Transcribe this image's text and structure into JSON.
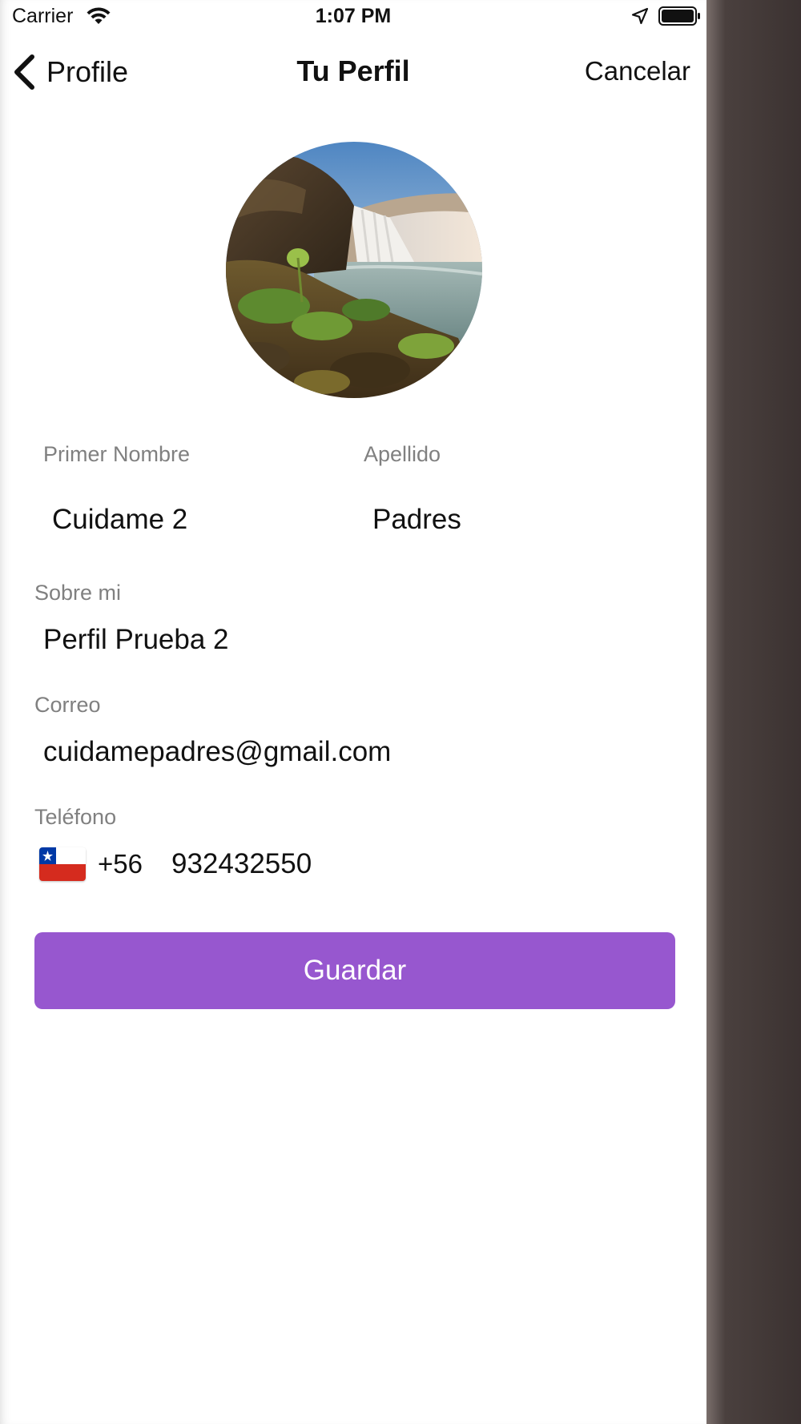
{
  "status_bar": {
    "carrier": "Carrier",
    "time": "1:07 PM",
    "icons": [
      "wifi-icon",
      "location-icon",
      "battery-icon"
    ]
  },
  "nav": {
    "back_label": "Profile",
    "title": "Tu Perfil",
    "cancel_label": "Cancelar"
  },
  "profile": {
    "first_name_label": "Primer Nombre",
    "first_name_value": "Cuidame 2",
    "last_name_label": "Apellido",
    "last_name_value": "Padres",
    "about_label": "Sobre mi",
    "about_value": "Perfil Prueba 2",
    "email_label": "Correo",
    "email_value": "cuidamepadres@gmail.com",
    "phone_label": "Teléfono",
    "phone_country_flag": "chile-flag-icon",
    "phone_dial_code": "+56",
    "phone_value": "932432550"
  },
  "actions": {
    "save_label": "Guardar"
  },
  "colors": {
    "accent": "#9757cf",
    "label_gray": "#808080",
    "text": "#111111"
  }
}
